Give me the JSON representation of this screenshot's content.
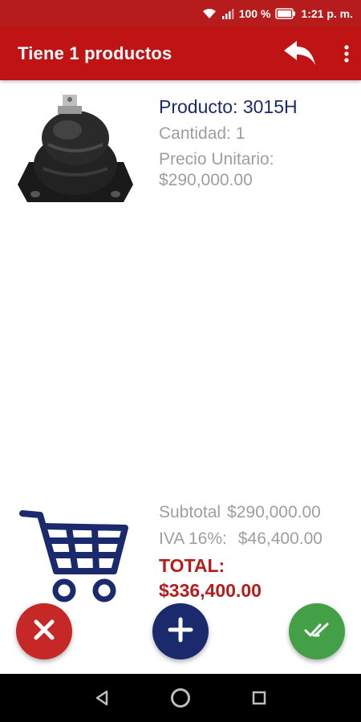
{
  "status_bar": {
    "battery": "100 %",
    "time": "1:21 p. m."
  },
  "app_bar": {
    "title": "Tiene 1 productos",
    "back_icon": "reply-arrow-icon",
    "menu_icon": "more-vert-icon"
  },
  "product": {
    "name": "Producto: 3015H",
    "quantity": "Cantidad: 1",
    "unit_price_label": "Precio Unitario:",
    "unit_price": "$290,000.00"
  },
  "summary": {
    "subtotal_label": "Subtotal",
    "subtotal_value": "$290,000.00",
    "iva_label": "IVA 16%:",
    "iva_value": "$46,400.00",
    "total_label": "TOTAL:",
    "total_value": "$336,400.00"
  },
  "colors": {
    "primary": "#c01414",
    "navy": "#1a2a6c",
    "green": "#43a047",
    "gray_text": "#9e9e9e"
  },
  "icons": {
    "cart": "shopping-cart-icon",
    "cancel": "close-icon",
    "add": "plus-icon",
    "confirm": "double-check-icon"
  }
}
